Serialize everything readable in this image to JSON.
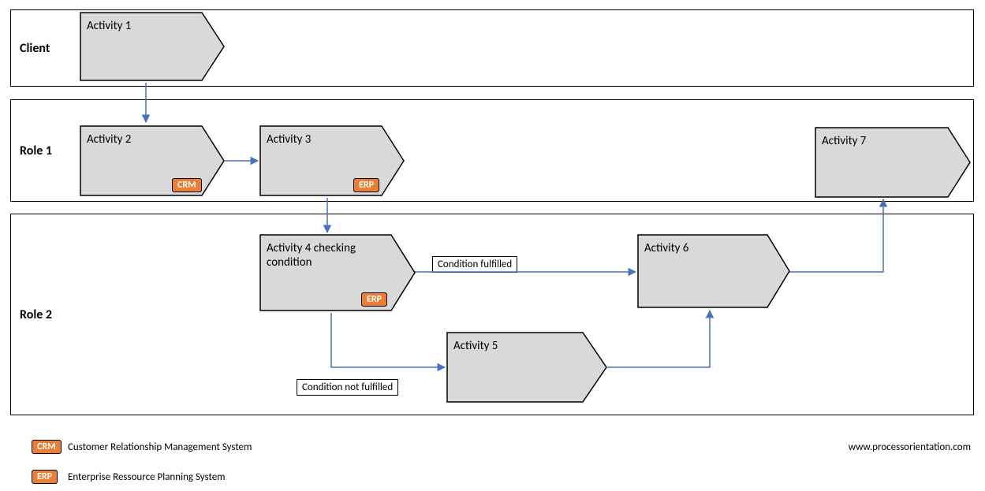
{
  "lanes": {
    "client": "Client",
    "role1": "Role 1",
    "role2": "Role 2"
  },
  "activities": {
    "a1": "Activity 1",
    "a2": "Activity 2",
    "a3": "Activity 3",
    "a4": "Activity 4 checking condition",
    "a5": "Activity 5",
    "a6": "Activity 6",
    "a7": "Activity 7"
  },
  "system_badges": {
    "a2": "CRM",
    "a3": "ERP",
    "a4": "ERP"
  },
  "condition_labels": {
    "fulfilled": "Condition fulfilled",
    "not_fulfilled": "Condition not fulfilled"
  },
  "legend": {
    "crm_badge": "CRM",
    "crm_text": "Customer Relationship Management System",
    "erp_badge": "ERP",
    "erp_text": "Enterprise Ressource Planning System"
  },
  "watermark": "www.processorientation.com"
}
